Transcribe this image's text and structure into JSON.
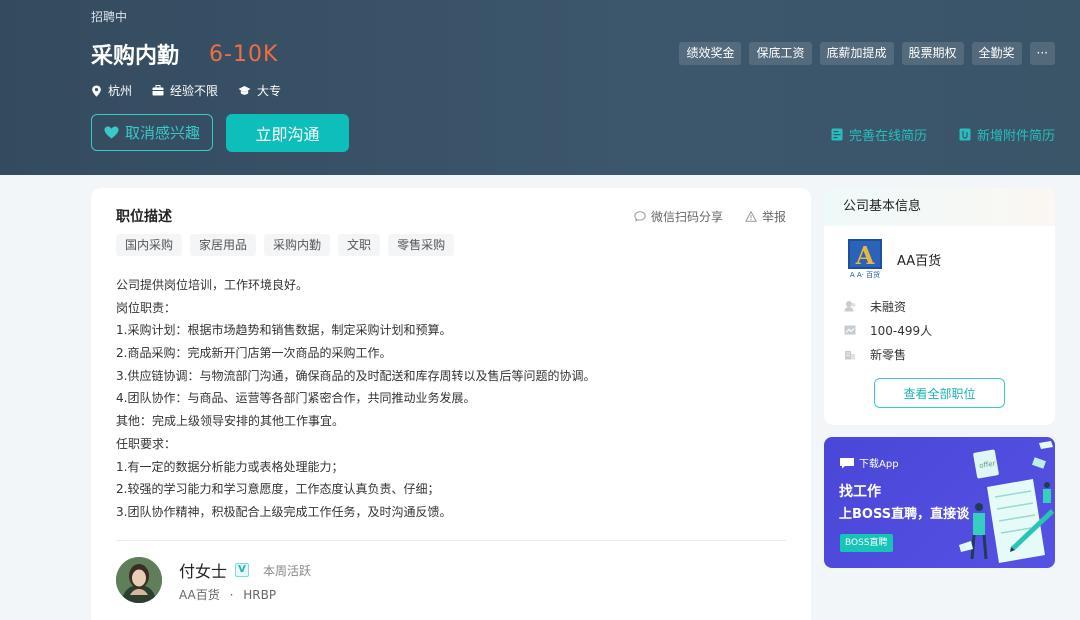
{
  "header": {
    "status": "招聘中",
    "title": "采购内勤",
    "salary": "6-10K",
    "meta": {
      "city": "杭州",
      "experience": "经验不限",
      "degree": "大专"
    },
    "tags": [
      "绩效奖金",
      "保底工资",
      "底薪加提成",
      "股票期权",
      "全勤奖",
      "···"
    ],
    "unfollow_label": "取消感兴趣",
    "chat_label": "立即沟通",
    "improve_resume_label": "完善在线简历",
    "add_attachment_label": "新增附件简历",
    "accent_color": "#0dbeba",
    "salary_color": "#f26d43"
  },
  "job": {
    "section_title": "职位描述",
    "share_label": "微信扫码分享",
    "report_label": "举报",
    "keywords": [
      "国内采购",
      "家居用品",
      "采购内勤",
      "文职",
      "零售采购"
    ],
    "description": [
      "公司提供岗位培训，工作环境良好。",
      "岗位职责：",
      "1.采购计划：根据市场趋势和销售数据，制定采购计划和预算。",
      "2.商品采购：完成新开门店第一次商品的采购工作。",
      "3.供应链协调：与物流部门沟通，确保商品的及时配送和库存周转以及售后等问题的协调。",
      "4.团队协作：与商品、运营等各部门紧密合作，共同推动业务发展。",
      "其他：完成上级领导安排的其他工作事宜。",
      "任职要求：",
      "1.有一定的数据分析能力或表格处理能力；",
      "2.较强的学习能力和学习意愿度，工作态度认真负责、仔细；",
      "3.团队协作精神，积极配合上级完成工作任务，及时沟通反馈。"
    ]
  },
  "recruiter": {
    "name": "付女士",
    "verified_mark": "V",
    "active_status": "本周活跃",
    "company": "AA百货",
    "separator": "·",
    "role": "HRBP"
  },
  "company": {
    "section_title": "公司基本信息",
    "logo_text": "A",
    "logo_caption": "A A· 百货",
    "name": "AA百货",
    "financing": "未融资",
    "size": "100-499人",
    "industry": "新零售",
    "view_all_label": "查看全部职位"
  },
  "banner": {
    "download_label": "下载App",
    "title": "找工作",
    "subtitle": "上BOSS直聘，直接谈",
    "button_label": "BOSS直聘",
    "paper_label": "offer"
  },
  "icons": {
    "location": "location-pin-icon",
    "experience": "briefcase-icon",
    "degree": "graduation-cap-icon",
    "heart": "heart-icon",
    "resume": "resume-icon",
    "attachment": "attachment-icon",
    "wechat": "wechat-chat-icon",
    "report": "warning-triangle-icon",
    "financing": "financing-icon",
    "size": "people-icon",
    "industry": "building-icon"
  }
}
